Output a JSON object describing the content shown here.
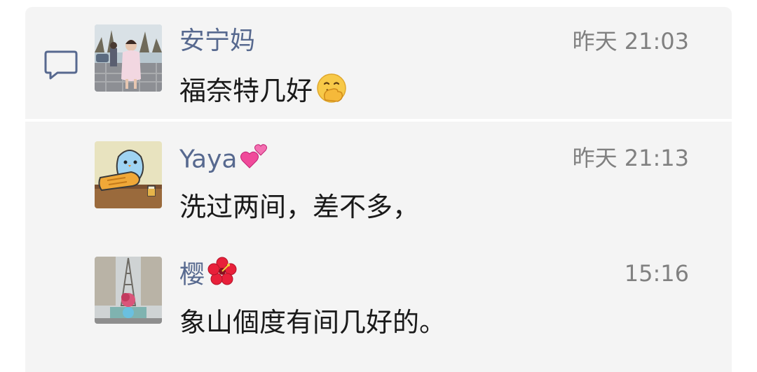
{
  "comments": [
    {
      "name": "安宁妈",
      "time": "昨天 21:03",
      "text": "福奈特几好",
      "text_emoji": "hand-over-mouth-emoji",
      "avatar": "photo-avatar-girl"
    },
    {
      "name": "Yaya",
      "name_emoji": "two-hearts-emoji",
      "time": "昨天 21:13",
      "text": "洗过两间，差不多，",
      "avatar": "cartoon-avatar-blue-bird"
    },
    {
      "name": "樱",
      "name_emoji": "hibiscus-emoji",
      "time": "15:16",
      "text": "象山個度有间几好的。",
      "avatar": "photo-avatar-eiffel-tower"
    }
  ],
  "colors": {
    "name": "#57698f",
    "time": "#808080",
    "text": "#1a1a1a",
    "panel": "#f4f4f4",
    "icon": "#57698f"
  },
  "icons": {
    "comment": "comment-bubble-icon"
  }
}
